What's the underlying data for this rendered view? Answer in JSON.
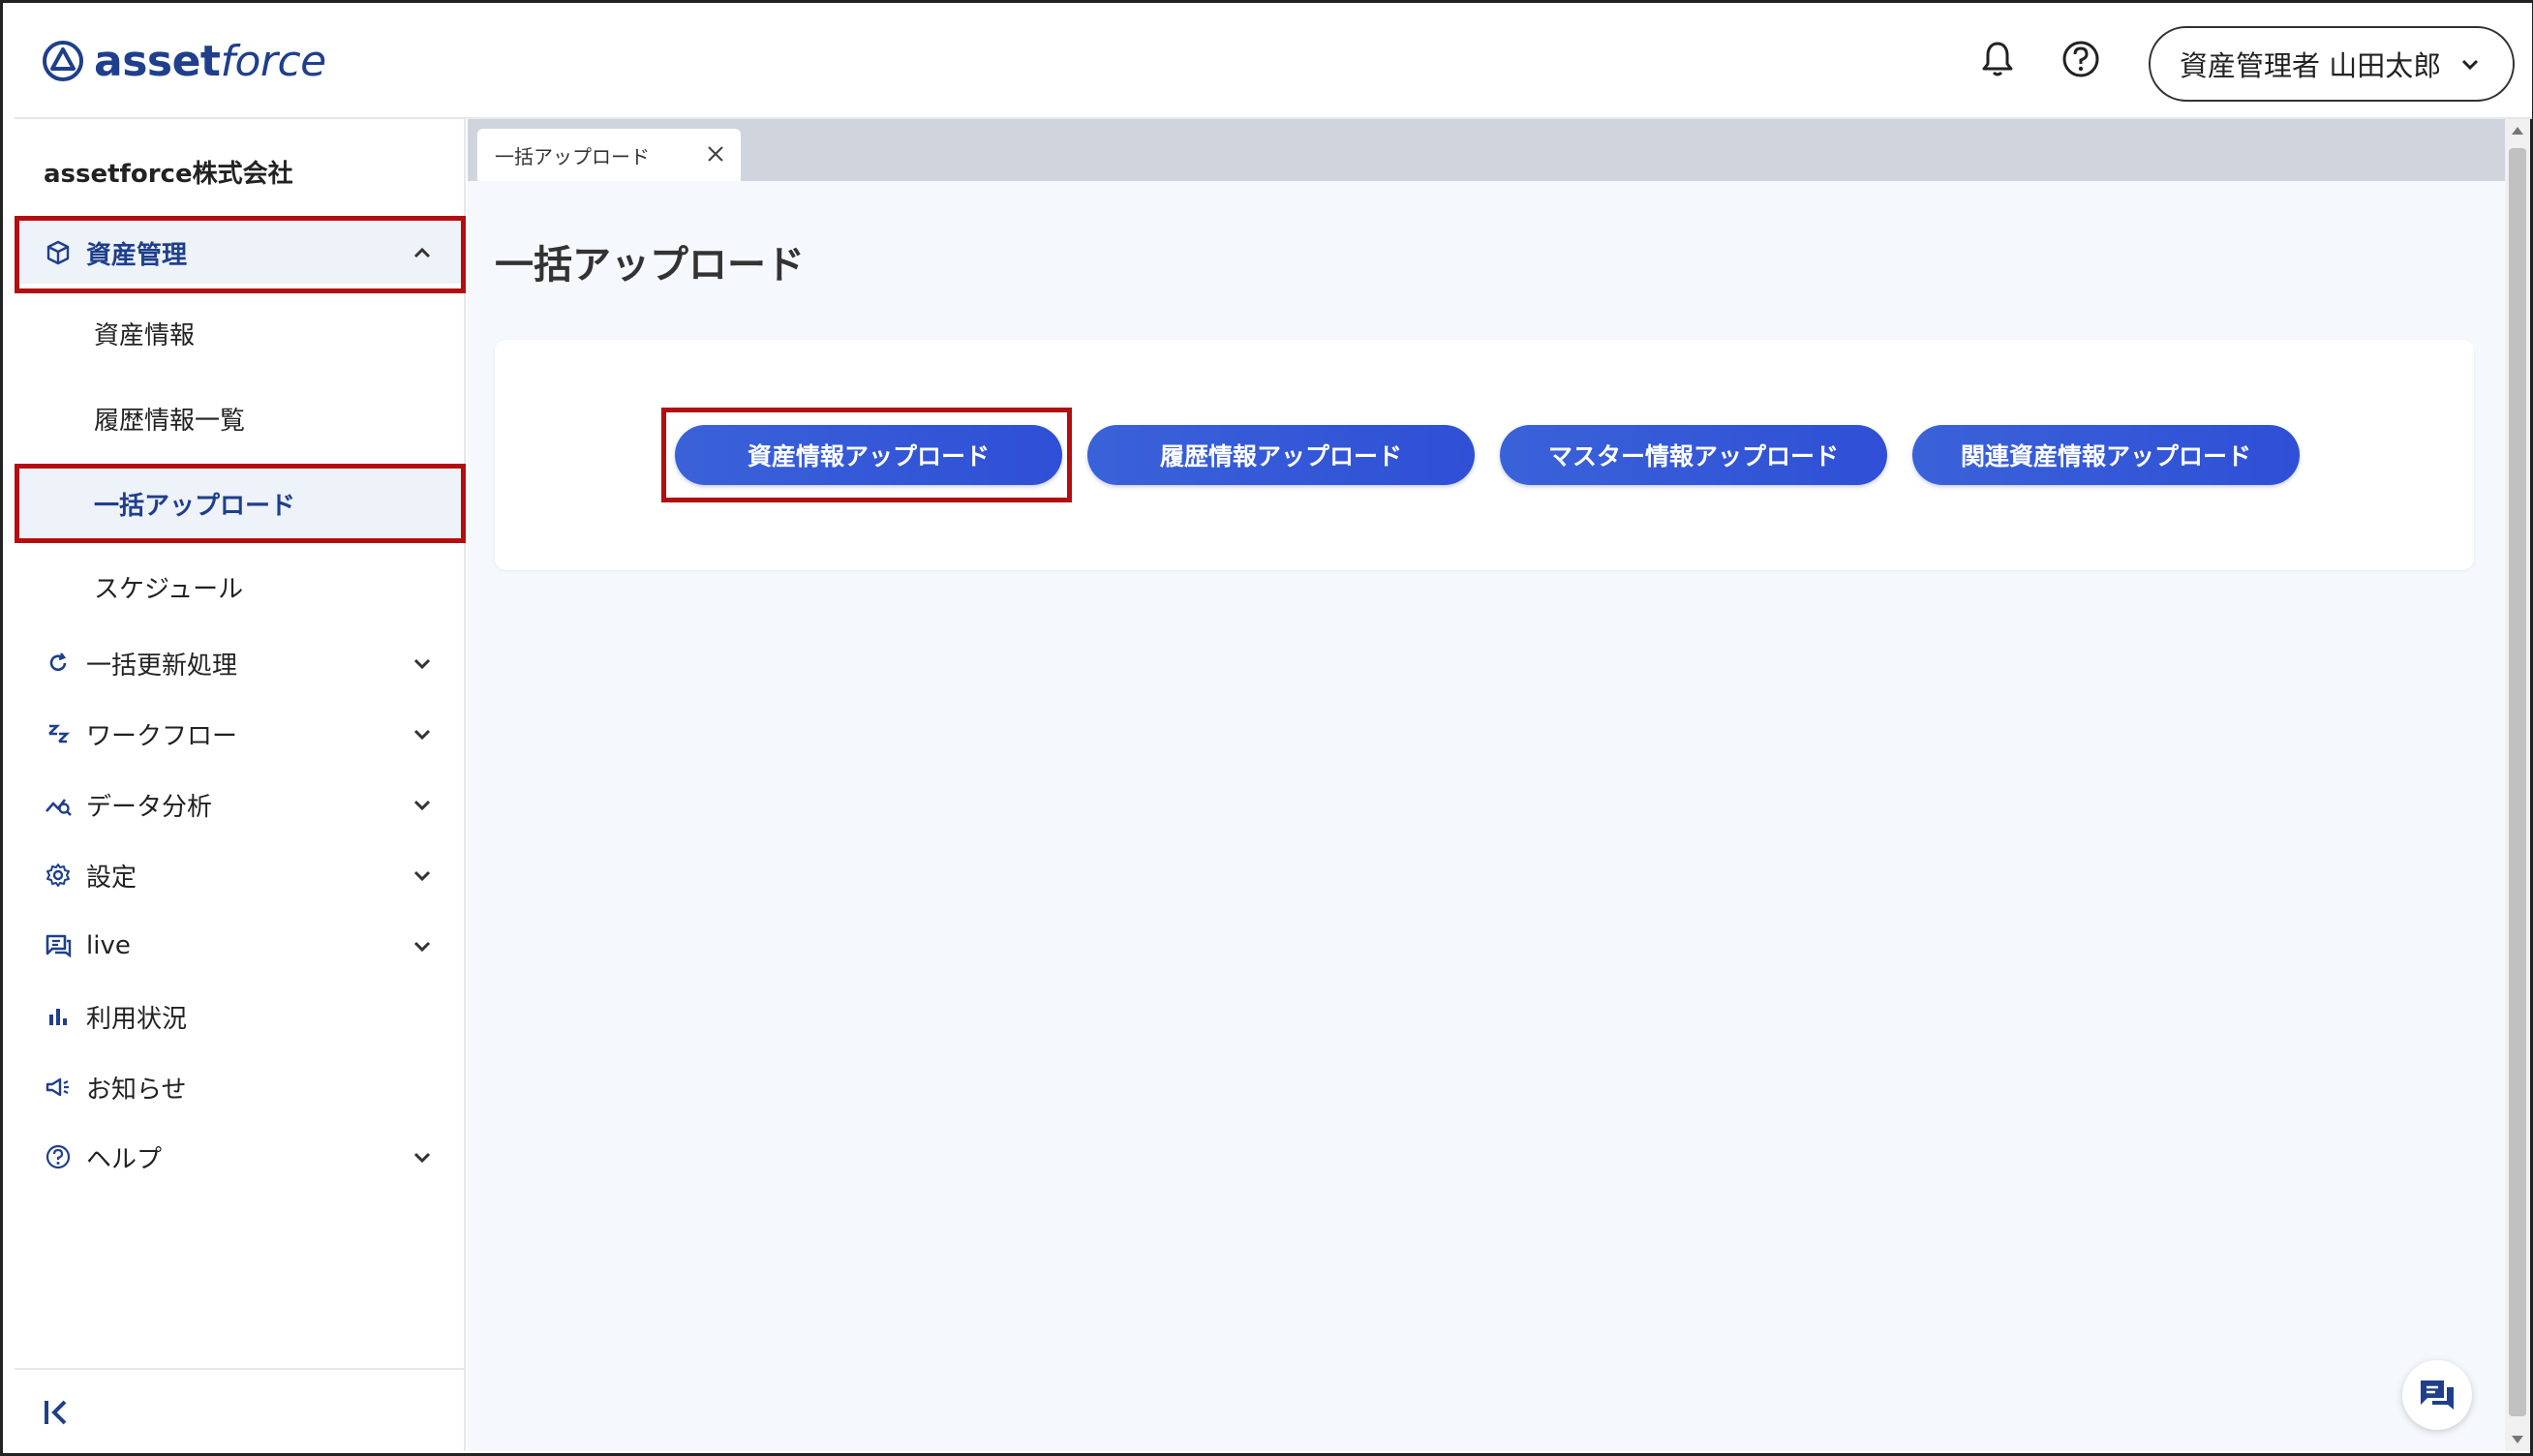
{
  "header": {
    "logo_asset": "asset",
    "logo_force": "force",
    "notification_icon": "bell-icon",
    "help_icon": "question-circle-icon",
    "user_label": "資産管理者 山田太郎",
    "user_chevron": "chevron-down-icon"
  },
  "sidebar": {
    "company": "assetforce株式会社",
    "items": [
      {
        "label": "資産管理",
        "icon": "box-icon",
        "chevron": "chevron-up-icon",
        "expanded": true
      },
      {
        "label": "一括更新処理",
        "icon": "refresh-icon",
        "chevron": "chevron-down-icon"
      },
      {
        "label": "ワークフロー",
        "icon": "workflow-icon",
        "chevron": "chevron-down-icon"
      },
      {
        "label": "データ分析",
        "icon": "analytics-icon",
        "chevron": "chevron-down-icon"
      },
      {
        "label": "設定",
        "icon": "gear-icon",
        "chevron": "chevron-down-icon"
      },
      {
        "label": "live",
        "icon": "chat-icon",
        "chevron": "chevron-down-icon"
      },
      {
        "label": "利用状況",
        "icon": "bar-chart-icon"
      },
      {
        "label": "お知らせ",
        "icon": "megaphone-icon"
      },
      {
        "label": "ヘルプ",
        "icon": "question-circle-icon",
        "chevron": "chevron-down-icon"
      }
    ],
    "subitems": [
      {
        "label": "資産情報"
      },
      {
        "label": "履歴情報一覧"
      },
      {
        "label": "一括アップロード",
        "active": true
      },
      {
        "label": "スケジュール"
      }
    ],
    "collapse_icon": "collapse-left-icon"
  },
  "main": {
    "tab_label": "一括アップロード",
    "tab_close_icon": "close-icon",
    "page_title": "一括アップロード",
    "buttons": [
      {
        "label": "資産情報アップロード"
      },
      {
        "label": "履歴情報アップロード"
      },
      {
        "label": "マスター情報アップロード"
      },
      {
        "label": "関連資産情報アップロード"
      }
    ],
    "chat_icon": "chat-bubble-icon"
  },
  "colors": {
    "brand": "#1f3f8c",
    "highlight": "#b40d10",
    "button": "#3a62d8",
    "tabbar": "#d0d5dd",
    "main_bg": "#f5f8fc"
  }
}
